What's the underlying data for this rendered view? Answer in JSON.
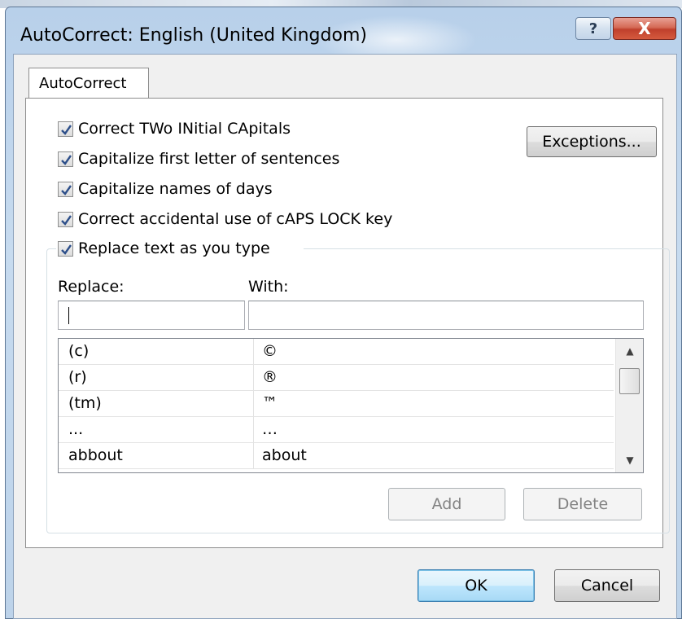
{
  "window": {
    "title": "AutoCorrect: English (United Kingdom)",
    "help_glyph": "?",
    "close_glyph": "X"
  },
  "tabs": [
    {
      "label": "AutoCorrect"
    }
  ],
  "options": [
    {
      "label": "Correct TWo INitial CApitals",
      "checked": true
    },
    {
      "label": "Capitalize first letter of sentences",
      "checked": true
    },
    {
      "label": "Capitalize names of days",
      "checked": true
    },
    {
      "label": "Correct accidental use of cAPS LOCK key",
      "checked": true
    },
    {
      "label": "Replace text as you type",
      "checked": true
    }
  ],
  "exceptions_label": "Exceptions...",
  "replace": {
    "replace_label": "Replace:",
    "with_label": "With:",
    "replace_value": "",
    "with_value": ""
  },
  "entries": [
    {
      "replace": "(c)",
      "with": "©"
    },
    {
      "replace": "(r)",
      "with": "®"
    },
    {
      "replace": "(tm)",
      "with": "™"
    },
    {
      "replace": "...",
      "with": "…"
    },
    {
      "replace": "abbout",
      "with": "about"
    }
  ],
  "actions": {
    "add_label": "Add",
    "delete_label": "Delete",
    "add_enabled": false,
    "delete_enabled": false
  },
  "footer": {
    "ok_label": "OK",
    "cancel_label": "Cancel"
  },
  "colors": {
    "frame": "#b8d0ea",
    "close_button": "#c0402c",
    "checkmark": "#2d4f8a"
  }
}
